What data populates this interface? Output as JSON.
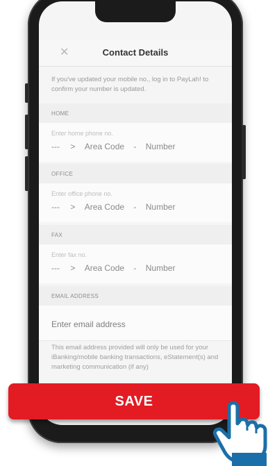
{
  "header": {
    "close_icon": "close-icon",
    "title": "Contact Details"
  },
  "info_text": "If you've updated your mobile no., log in to PayLah! to confirm your number is updated.",
  "sections": {
    "home": {
      "label": "HOME",
      "placeholder": "Enter home phone no.",
      "country": "---",
      "chevron": ">",
      "area": "Area Code",
      "dash": "-",
      "number": "Number"
    },
    "office": {
      "label": "OFFICE",
      "placeholder": "Enter office phone no.",
      "country": "---",
      "chevron": ">",
      "area": "Area Code",
      "dash": "-",
      "number": "Number"
    },
    "fax": {
      "label": "FAX",
      "placeholder": "Enter fax no.",
      "country": "---",
      "chevron": ">",
      "area": "Area Code",
      "dash": "-",
      "number": "Number"
    },
    "email": {
      "label": "EMAIL ADDRESS",
      "placeholder": "Enter email address",
      "note": "This email address provided will only be used for your iBanking/mobile banking transactions, eStatement(s) and marketing communication (if any)"
    }
  },
  "save_button": {
    "label": "SAVE",
    "color": "#e31b23"
  },
  "pointer_icon": "hand-pointer-icon"
}
